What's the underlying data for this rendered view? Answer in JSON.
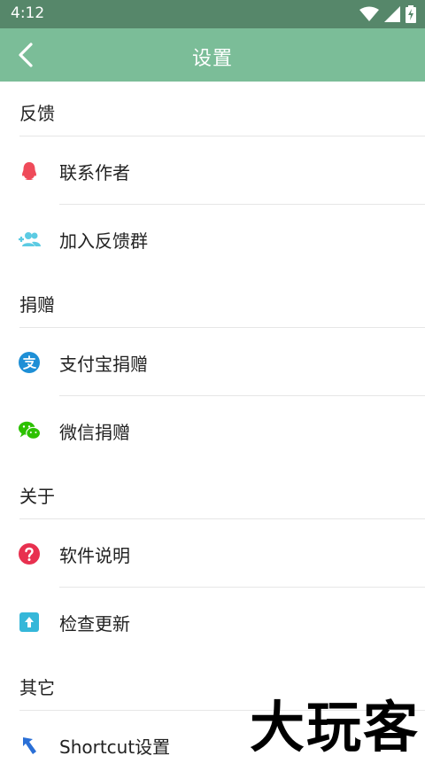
{
  "status_bar": {
    "time": "4:12"
  },
  "app_bar": {
    "title": "设置"
  },
  "sections": [
    {
      "header": "反馈",
      "items": [
        {
          "label": "联系作者",
          "icon": "qq-icon"
        },
        {
          "label": "加入反馈群",
          "icon": "add-group-icon"
        }
      ]
    },
    {
      "header": "捐赠",
      "items": [
        {
          "label": "支付宝捐赠",
          "icon": "alipay-icon"
        },
        {
          "label": "微信捐赠",
          "icon": "wechat-icon"
        }
      ]
    },
    {
      "header": "关于",
      "items": [
        {
          "label": "软件说明",
          "icon": "help-icon"
        },
        {
          "label": "检查更新",
          "icon": "update-icon"
        }
      ]
    },
    {
      "header": "其它",
      "items": [
        {
          "label": "Shortcut设置",
          "icon": "shortcut-icon"
        }
      ]
    }
  ],
  "watermark": "大玩客",
  "colors": {
    "status_bar": "#56876a",
    "app_bar": "#7bbd98"
  }
}
